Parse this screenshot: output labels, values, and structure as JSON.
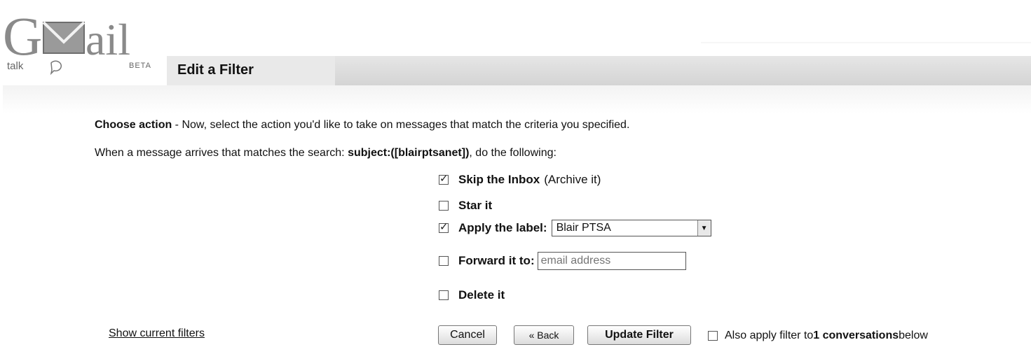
{
  "logo": {
    "word": "Gmail",
    "talk": "talk",
    "beta": "BETA"
  },
  "page": {
    "title": "Edit a Filter"
  },
  "instructions": {
    "lead": "Choose action",
    "rest": " - Now, select the action you'd like to take on messages that match the criteria you specified."
  },
  "match_line": {
    "prefix": "When a message arrives that matches the search: ",
    "query": "subject:([blairptsanet])",
    "suffix": ", do the following:"
  },
  "actions": {
    "skip_inbox": {
      "label": "Skip the Inbox",
      "note": "(Archive it)",
      "checked": true
    },
    "star": {
      "label": "Star it",
      "checked": false
    },
    "apply_label": {
      "label": "Apply the label:",
      "checked": true,
      "selected": "Blair PTSA"
    },
    "forward": {
      "label": "Forward it to:",
      "checked": false,
      "placeholder": "email address"
    },
    "delete": {
      "label": "Delete it",
      "checked": false
    }
  },
  "footer": {
    "show_filters": "Show current filters",
    "cancel": "Cancel",
    "back": "« Back",
    "update": "Update Filter",
    "apply_prefix": "Also apply filter to ",
    "apply_count": "1 conversations",
    "apply_suffix": " below"
  },
  "colors": {
    "header_band": "#d6d6d6",
    "logo_gray": "#8a8a8a"
  }
}
